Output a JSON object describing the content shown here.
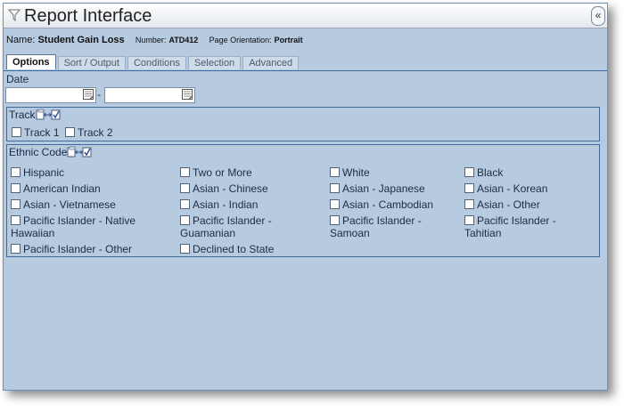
{
  "window": {
    "title": "Report Interface",
    "collapse_label": "«"
  },
  "info": {
    "name_label": "Name:",
    "name_value": "Student Gain Loss",
    "number_label": "Number:",
    "number_value": "ATD412",
    "orientation_label": "Page Orientation:",
    "orientation_value": "Portrait"
  },
  "tabs": [
    {
      "label": "Options",
      "active": true
    },
    {
      "label": "Sort / Output"
    },
    {
      "label": "Conditions"
    },
    {
      "label": "Selection"
    },
    {
      "label": "Advanced"
    }
  ],
  "date": {
    "label": "Date",
    "from_value": "",
    "to_value": "",
    "separator": "-"
  },
  "track": {
    "title": "Track",
    "items": [
      {
        "label": "Track 1",
        "checked": false
      },
      {
        "label": "Track 2",
        "checked": false
      }
    ]
  },
  "ethnic": {
    "title": "Ethnic Code",
    "items": [
      {
        "label": "Hispanic"
      },
      {
        "label": "Two or More"
      },
      {
        "label": "White"
      },
      {
        "label": "Black"
      },
      {
        "label": "American Indian"
      },
      {
        "label": "Asian - Chinese"
      },
      {
        "label": "Asian - Japanese"
      },
      {
        "label": "Asian - Korean"
      },
      {
        "label": "Asian - Vietnamese"
      },
      {
        "label": "Asian - Indian"
      },
      {
        "label": "Asian - Cambodian"
      },
      {
        "label": "Asian - Other"
      },
      {
        "label": "Pacific Islander - Native",
        "label2": "Hawaiian"
      },
      {
        "label": "Pacific Islander -",
        "label2": "Guamanian"
      },
      {
        "label": "Pacific Islander -",
        "label2": "Samoan"
      },
      {
        "label": "Pacific Islander -",
        "label2": "Tahitian"
      },
      {
        "label": "Pacific Islander - Other"
      },
      {
        "label": "Declined to State"
      }
    ]
  }
}
